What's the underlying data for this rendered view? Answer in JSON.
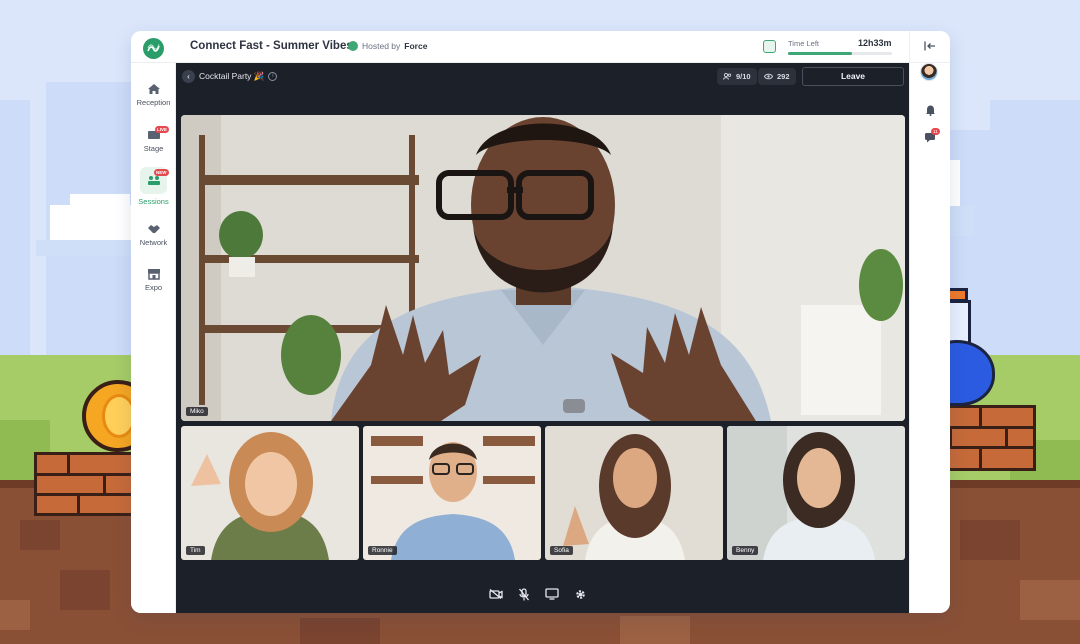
{
  "app": {
    "title": "Connect Fast - Summer Vibes",
    "hosted_by_label": "Hosted by",
    "host_name": "Force",
    "time_left_label": "Time Left",
    "time_left_value": "12h33m",
    "time_left_progress": 0.62
  },
  "sidebar": {
    "items": [
      {
        "label": "Reception",
        "icon": "home-icon"
      },
      {
        "label": "Stage",
        "icon": "stage-icon",
        "badge": "LIVE"
      },
      {
        "label": "Sessions",
        "icon": "sessions-icon",
        "badge": "NEW",
        "active": true
      },
      {
        "label": "Network",
        "icon": "handshake-icon"
      },
      {
        "label": "Expo",
        "icon": "store-icon"
      }
    ]
  },
  "room": {
    "name": "Cocktail Party 🎉",
    "participants": "9/10",
    "viewers": "292",
    "leave_label": "Leave"
  },
  "videos": {
    "main": {
      "name": "Miko"
    },
    "tiles": [
      {
        "name": "Tim"
      },
      {
        "name": "Ronnie"
      },
      {
        "name": "Sofia"
      },
      {
        "name": "Benny"
      }
    ]
  },
  "right_rail": {
    "chat_badge": "11"
  },
  "colors": {
    "accent": "#2a9d6a",
    "stage_bg": "#1c2029",
    "badge": "#e5484d"
  }
}
